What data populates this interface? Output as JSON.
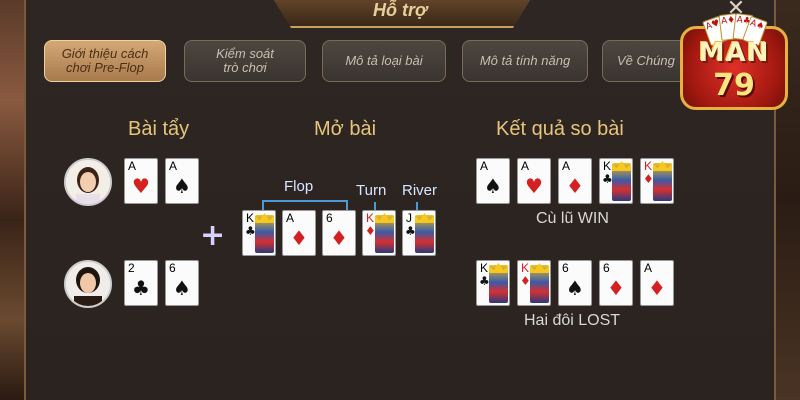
{
  "window": {
    "title": "Hỗ trợ",
    "close_label": "✕"
  },
  "tabs": [
    {
      "label": "Giới thiệu cách\nchơi Pre-Flop",
      "active": true
    },
    {
      "label": "Kiểm soát\ntrò chơi",
      "active": false
    },
    {
      "label": "Mô tả loại bài",
      "active": false
    },
    {
      "label": "Mô tả tính năng",
      "active": false
    },
    {
      "label": "Về Chúng",
      "active": false
    }
  ],
  "sections": {
    "hand": "Bài tẩy",
    "board": "Mở bài",
    "result": "Kết quả so bài"
  },
  "players": [
    {
      "cards": [
        {
          "rank": "A",
          "suit": "♥",
          "color": "red"
        },
        {
          "rank": "A",
          "suit": "♠",
          "color": "black"
        }
      ]
    },
    {
      "cards": [
        {
          "rank": "2",
          "suit": "♣",
          "color": "black"
        },
        {
          "rank": "6",
          "suit": "♠",
          "color": "black"
        }
      ]
    }
  ],
  "board": {
    "plus": "+",
    "flop_label": "Flop",
    "turn_label": "Turn",
    "river_label": "River",
    "cards": [
      {
        "rank": "K",
        "suit": "♣",
        "color": "black",
        "face": true
      },
      {
        "rank": "A",
        "suit": "♦",
        "color": "red",
        "face": false
      },
      {
        "rank": "6",
        "suit": "♦",
        "color": "red",
        "face": false
      },
      {
        "rank": "K",
        "suit": "♦",
        "color": "red",
        "face": true
      },
      {
        "rank": "J",
        "suit": "♣",
        "color": "black",
        "face": true
      }
    ]
  },
  "results": [
    {
      "label": "Cù lũ WIN",
      "cards": [
        {
          "rank": "A",
          "suit": "♠",
          "color": "black",
          "face": false
        },
        {
          "rank": "A",
          "suit": "♥",
          "color": "red",
          "face": false
        },
        {
          "rank": "A",
          "suit": "♦",
          "color": "red",
          "face": false
        },
        {
          "rank": "K",
          "suit": "♣",
          "color": "black",
          "face": true
        },
        {
          "rank": "K",
          "suit": "♦",
          "color": "red",
          "face": true
        }
      ]
    },
    {
      "label": "Hai đôi LOST",
      "cards": [
        {
          "rank": "K",
          "suit": "♣",
          "color": "black",
          "face": true
        },
        {
          "rank": "K",
          "suit": "♦",
          "color": "red",
          "face": true
        },
        {
          "rank": "6",
          "suit": "♠",
          "color": "black",
          "face": false
        },
        {
          "rank": "6",
          "suit": "♦",
          "color": "red",
          "face": false
        },
        {
          "rank": "A",
          "suit": "♦",
          "color": "red",
          "face": false
        }
      ]
    }
  ],
  "logo": {
    "text": "MAN",
    "number": "79"
  },
  "colors": {
    "accent": "#e6c47a",
    "active_tab": "#c9956a",
    "bracket": "#4a9ad8"
  }
}
